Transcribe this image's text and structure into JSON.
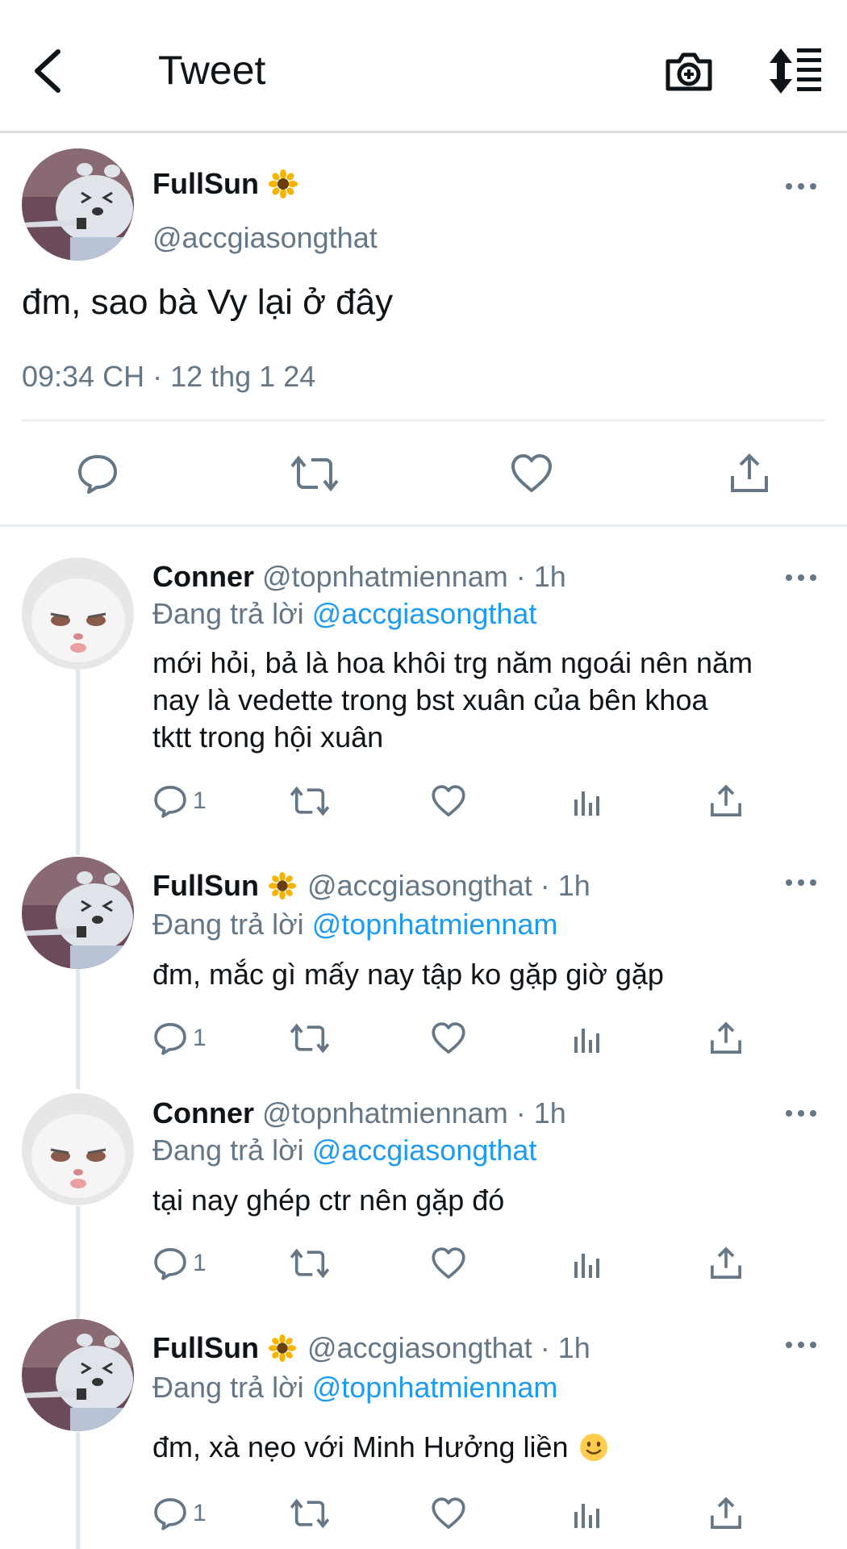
{
  "header": {
    "title": "Tweet"
  },
  "main_tweet": {
    "name": "FullSun",
    "handle": "@accgiasongthat",
    "text": "đm, sao bà Vy lại ở đây",
    "timestamp": "09:34 CH · 12 thg 1 24"
  },
  "replies": [
    {
      "name": "Conner",
      "handle": "@topnhatmiennam · 1h",
      "replying_prefix": "Đang trả lời",
      "replying_to": "@accgiasongthat",
      "text": "mới hỏi, bả là hoa khôi trg năm ngoái nên năm\nnay là vedette trong bst xuân của bên khoa\ntktt trong hội xuân",
      "reply_count": "1"
    },
    {
      "name": "FullSun",
      "handle": "@accgiasongthat · 1h",
      "replying_prefix": "Đang trả lời",
      "replying_to": "@topnhatmiennam",
      "text": "đm, mắc gì mấy nay tập ko gặp giờ gặp",
      "reply_count": "1"
    },
    {
      "name": "Conner",
      "handle": "@topnhatmiennam · 1h",
      "replying_prefix": "Đang trả lời",
      "replying_to": "@accgiasongthat",
      "text": "tại nay ghép ctr nên gặp đó",
      "reply_count": "1"
    },
    {
      "name": "FullSun",
      "handle": "@accgiasongthat · 1h",
      "replying_prefix": "Đang trả lời",
      "replying_to": "@topnhatmiennam",
      "text": "đm, xà nẹo với Minh Hưởng liền",
      "reply_count": "1"
    }
  ],
  "icons": {
    "back": "chevron-left-icon",
    "camera": "camera-plus-icon",
    "sort": "sort-icon",
    "reply": "comment-icon",
    "retweet": "retweet-icon",
    "like": "heart-icon",
    "views": "analytics-icon",
    "share": "share-icon",
    "more": "more-icon",
    "sunflower": "sunflower-emoji",
    "smile": "slight-smile-emoji"
  },
  "colors": {
    "accent": "#1d9bf0",
    "secondary_text": "#657786",
    "primary_text": "#0f1419"
  }
}
